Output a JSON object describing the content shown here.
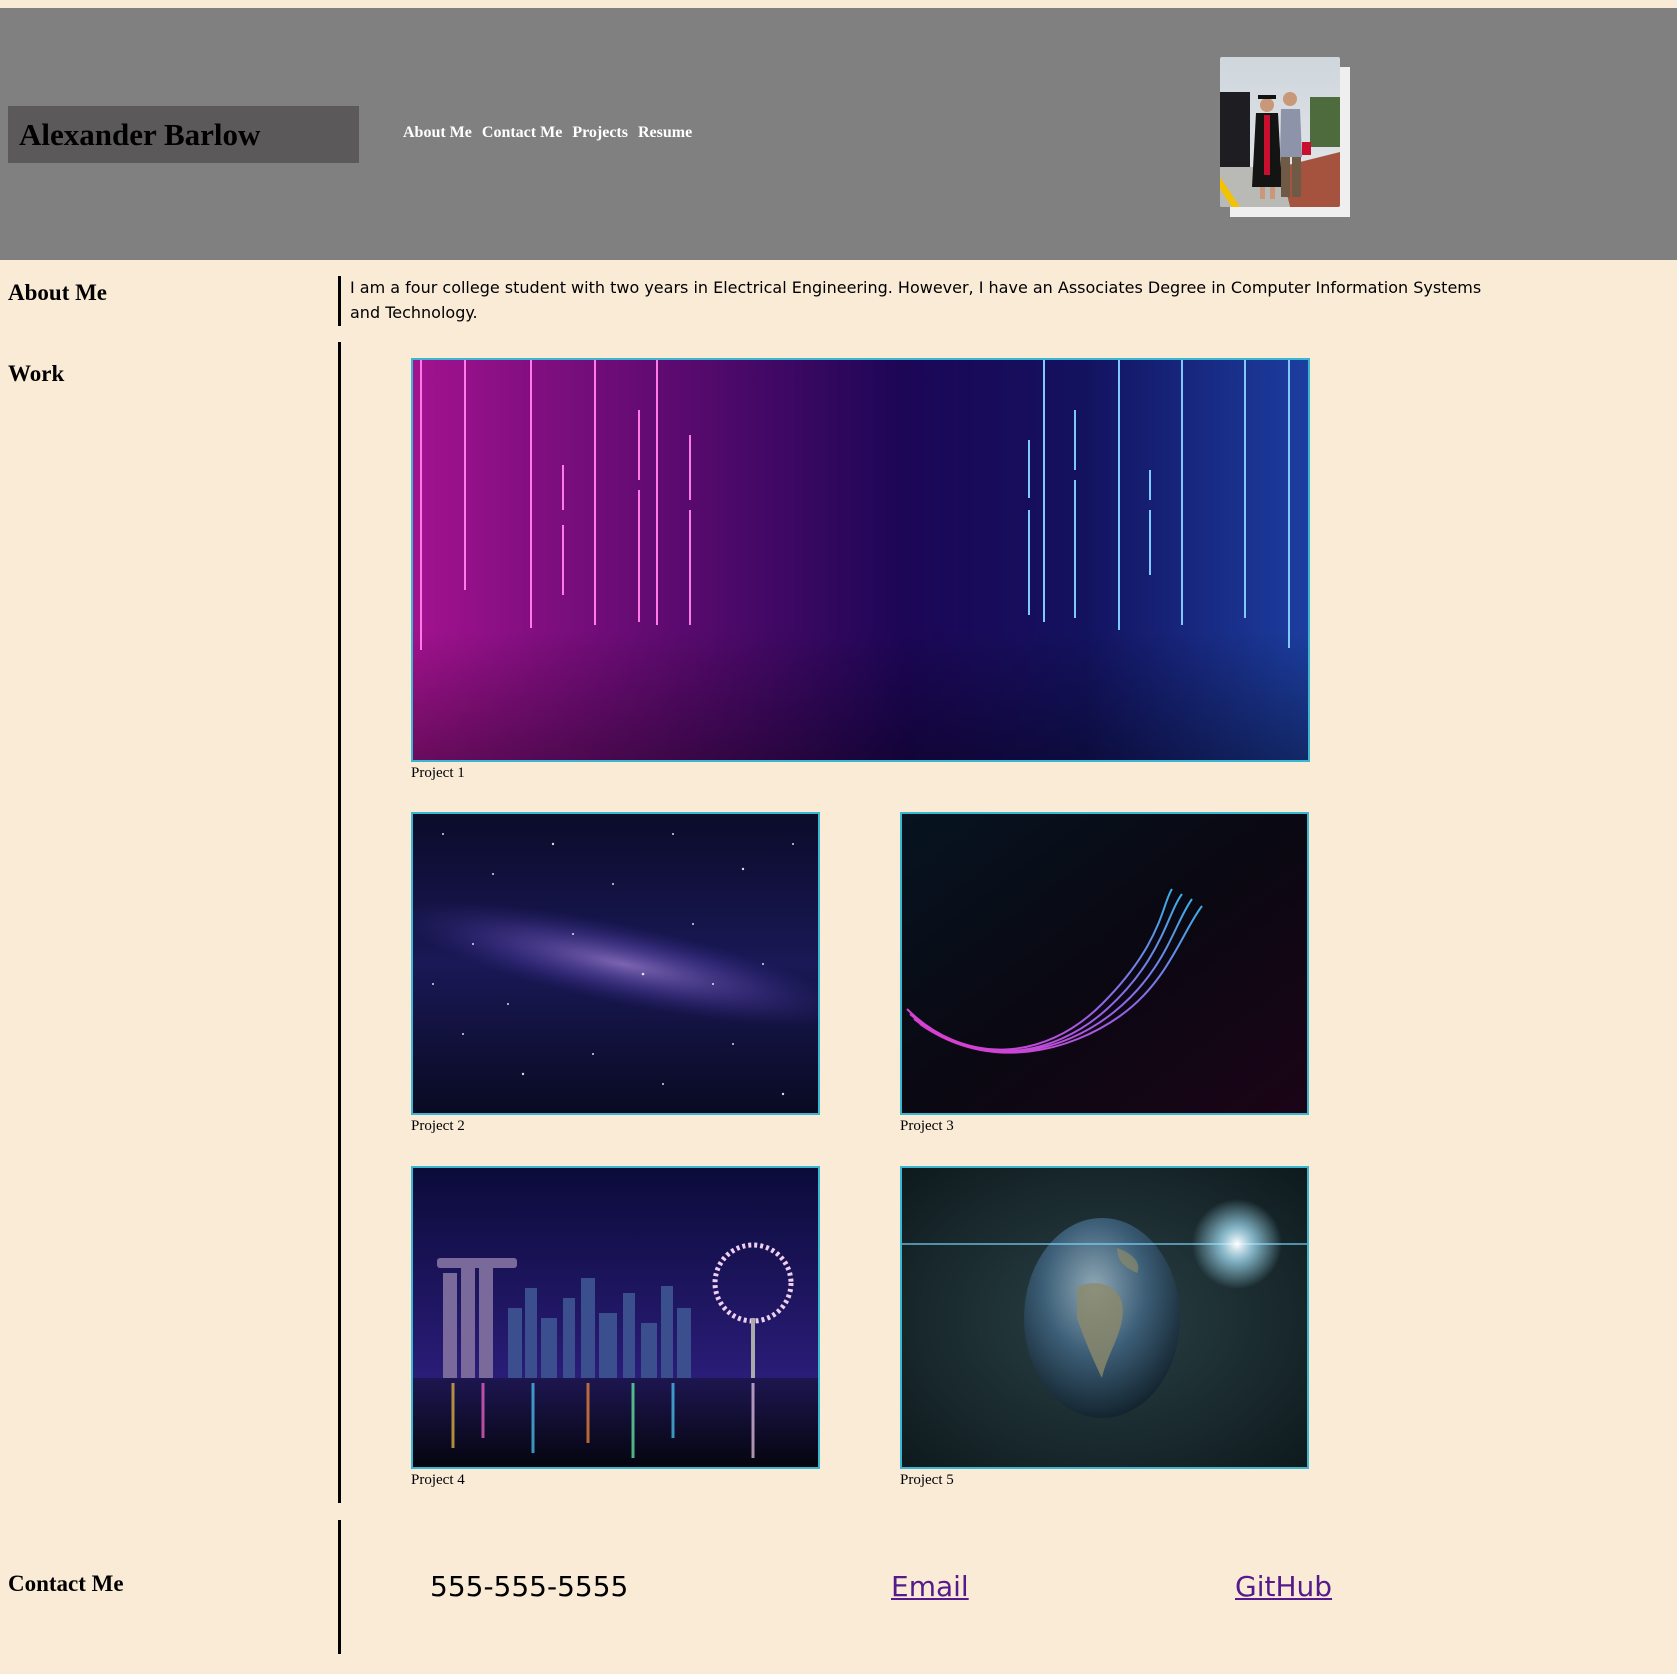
{
  "header": {
    "name": "Alexander Barlow",
    "nav": [
      "About Me",
      "Contact Me",
      "Projects",
      "Resume"
    ],
    "photo_alt": "graduation-photo"
  },
  "about": {
    "title": "About Me",
    "text": "I am a four college student with two years in Electrical Engineering. However, I have an Associates Degree in Computer Information Systems and Technology."
  },
  "work": {
    "title": "Work",
    "projects": [
      {
        "caption": "Project 1"
      },
      {
        "caption": "Project 2"
      },
      {
        "caption": "Project 3"
      },
      {
        "caption": "Project 4"
      },
      {
        "caption": "Project 5"
      }
    ]
  },
  "contact": {
    "title": "Contact Me",
    "phone": "555-555-5555",
    "email_label": "Email",
    "github_label": "GitHub"
  },
  "colors": {
    "background": "#faebd7",
    "header": "#808080",
    "name_box": "#5b5959",
    "image_border": "#39b7d1",
    "link": "#551a8b"
  }
}
